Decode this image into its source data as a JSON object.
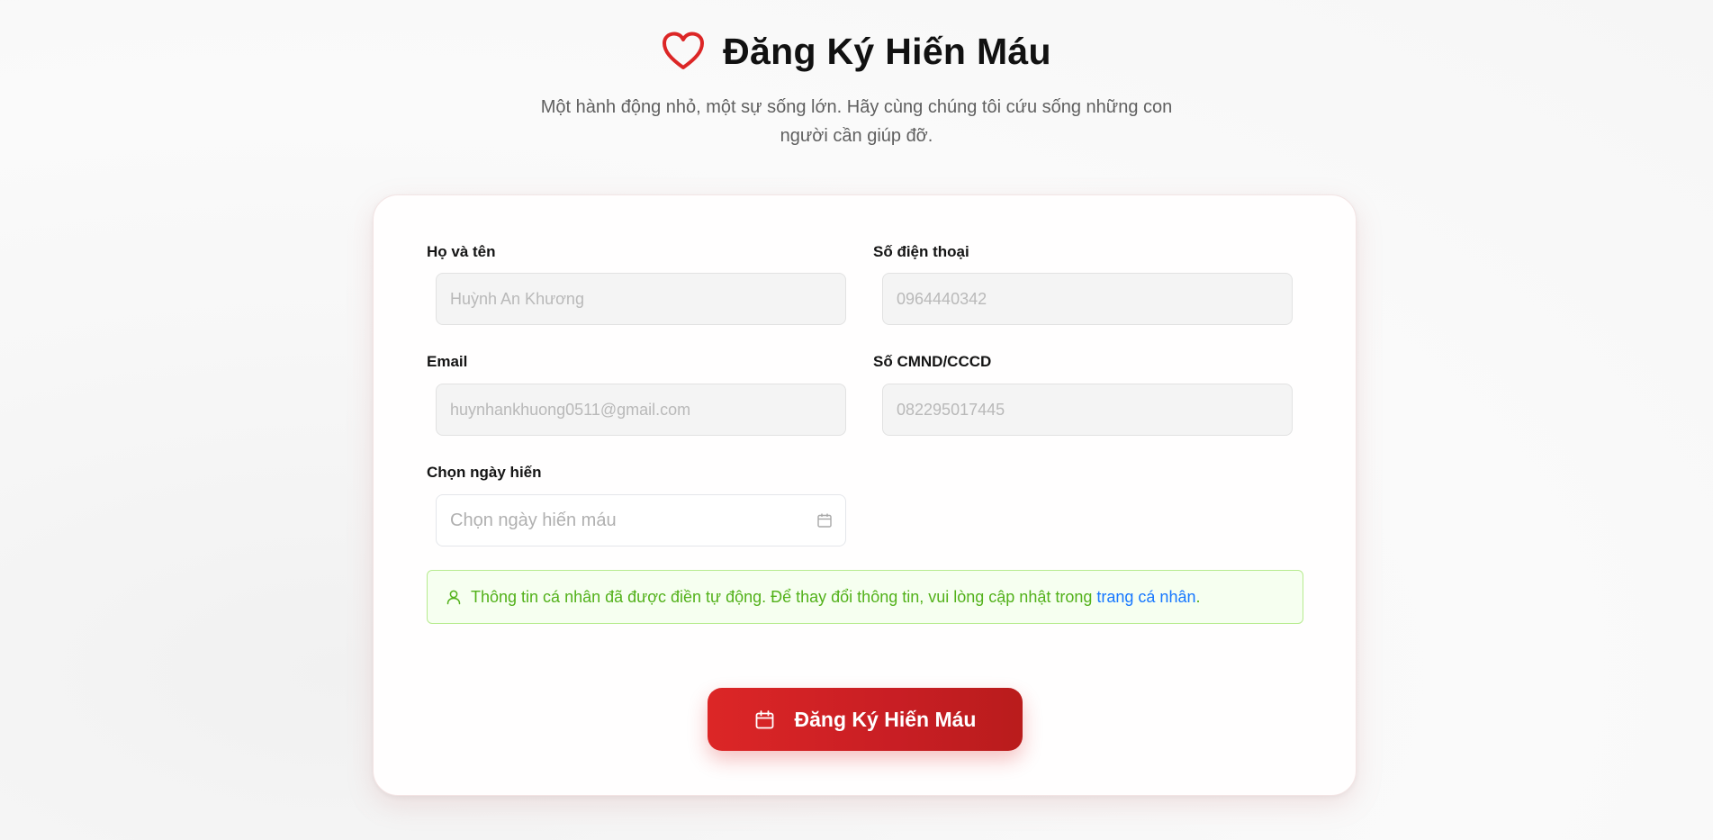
{
  "header": {
    "title": "Đăng Ký Hiến Máu",
    "subtitle": "Một hành động nhỏ, một sự sống lớn. Hãy cùng chúng tôi cứu sống những con người cần giúp đỡ.",
    "icon": "heart-outline-icon",
    "accent_color": "#dc2626"
  },
  "form": {
    "full_name": {
      "label": "Họ và tên",
      "value": "Huỳnh An Khương"
    },
    "phone": {
      "label": "Số điện thoại",
      "value": "0964440342"
    },
    "email": {
      "label": "Email",
      "value": "huynhankhuong0511@gmail.com"
    },
    "id_number": {
      "label": "Số CMND/CCCD",
      "value": "082295017445"
    },
    "donation_date": {
      "label": "Chọn ngày hiến",
      "placeholder": "Chọn ngày hiến máu",
      "icon": "calendar-icon"
    }
  },
  "notice": {
    "icon": "user-icon",
    "text": "Thông tin cá nhân đã được điền tự động. Để thay đổi thông tin, vui lòng cập nhật trong",
    "link_text": "trang cá nhân",
    "suffix": ".",
    "text_color": "#52b11a",
    "link_color": "#1677ff"
  },
  "submit": {
    "label": "Đăng Ký Hiến Máu",
    "icon": "calendar-icon",
    "color": "#dc2626"
  }
}
